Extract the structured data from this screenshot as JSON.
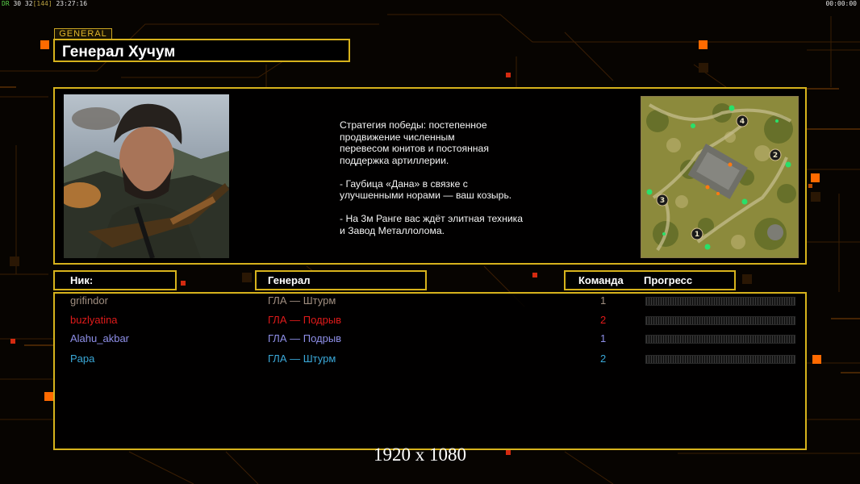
{
  "hud": {
    "fps_label": "DR",
    "fps_value": "30 32",
    "ms_value": "[144]",
    "time": "23:27:16",
    "timer": "00:00:00"
  },
  "general": {
    "tag": "GENERAL",
    "name": "Генерал Хучум"
  },
  "description": "Стратегия победы: постепенное\nпродвижение численным\nперевесом юнитов и постоянная\nподдержка артиллерии.\n\n- Гаубица «Дана» в связке с\nулучшенными норами — ваш козырь.\n\n- На 3м Ранге вас ждёт элитная техника\nи Завод Металлолома.",
  "minimap": {
    "spawns": [
      "1",
      "2",
      "3",
      "4"
    ]
  },
  "table": {
    "headers": {
      "nick": "Ник:",
      "general": "Генерал",
      "team": "Команда",
      "progress": "Прогресс"
    },
    "rows": [
      {
        "nick": "grifindor",
        "general": "ГЛА — Штурм",
        "team": "1",
        "color": "#a08e80"
      },
      {
        "nick": "buzlyatina",
        "general": "ГЛА — Подрыв",
        "team": "2",
        "color": "#e01a1a"
      },
      {
        "nick": "Alahu_akbar",
        "general": "ГЛА — Подрыв",
        "team": "1",
        "color": "#8f8fe8"
      },
      {
        "nick": "Papa",
        "general": "ГЛА — Штурм",
        "team": "2",
        "color": "#3aa8d8"
      }
    ]
  },
  "resolution": "1920 x 1080",
  "colors": {
    "accent": "#d6b21c",
    "orange": "#ff6a00"
  }
}
